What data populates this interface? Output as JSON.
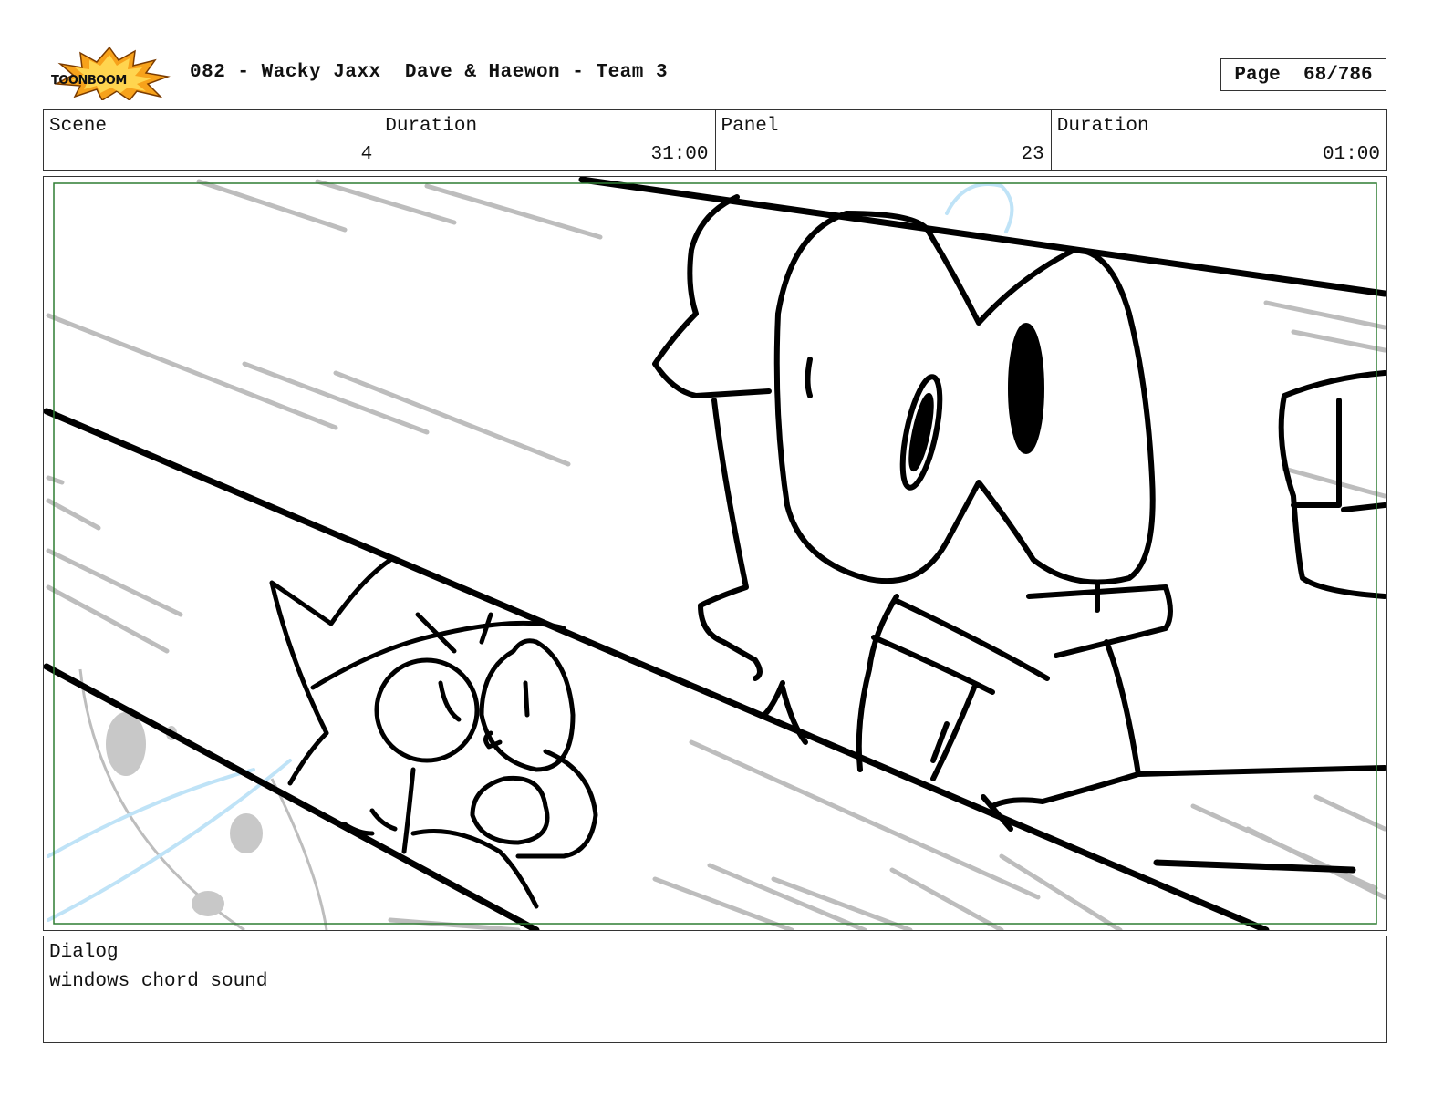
{
  "header": {
    "logo_text": "TOONBOOM",
    "title": "082 - Wacky Jaxx  Dave & Haewon - Team 3",
    "page_label": "Page",
    "page_value": "68/786"
  },
  "info": {
    "scene_label": "Scene",
    "scene_value": "4",
    "scene_duration_label": "Duration",
    "scene_duration_value": "31:00",
    "panel_label": "Panel",
    "panel_value": "23",
    "panel_duration_label": "Duration",
    "panel_duration_value": "01:00"
  },
  "dialog": {
    "label": "Dialog",
    "text": "windows chord sound"
  },
  "colors": {
    "safe_frame": "#2e7d32",
    "sketch_line": "#000000",
    "sketch_rough": "#bdbdbd",
    "sketch_blue": "#bfe3f7",
    "logo_burst": "#f7a21b"
  }
}
